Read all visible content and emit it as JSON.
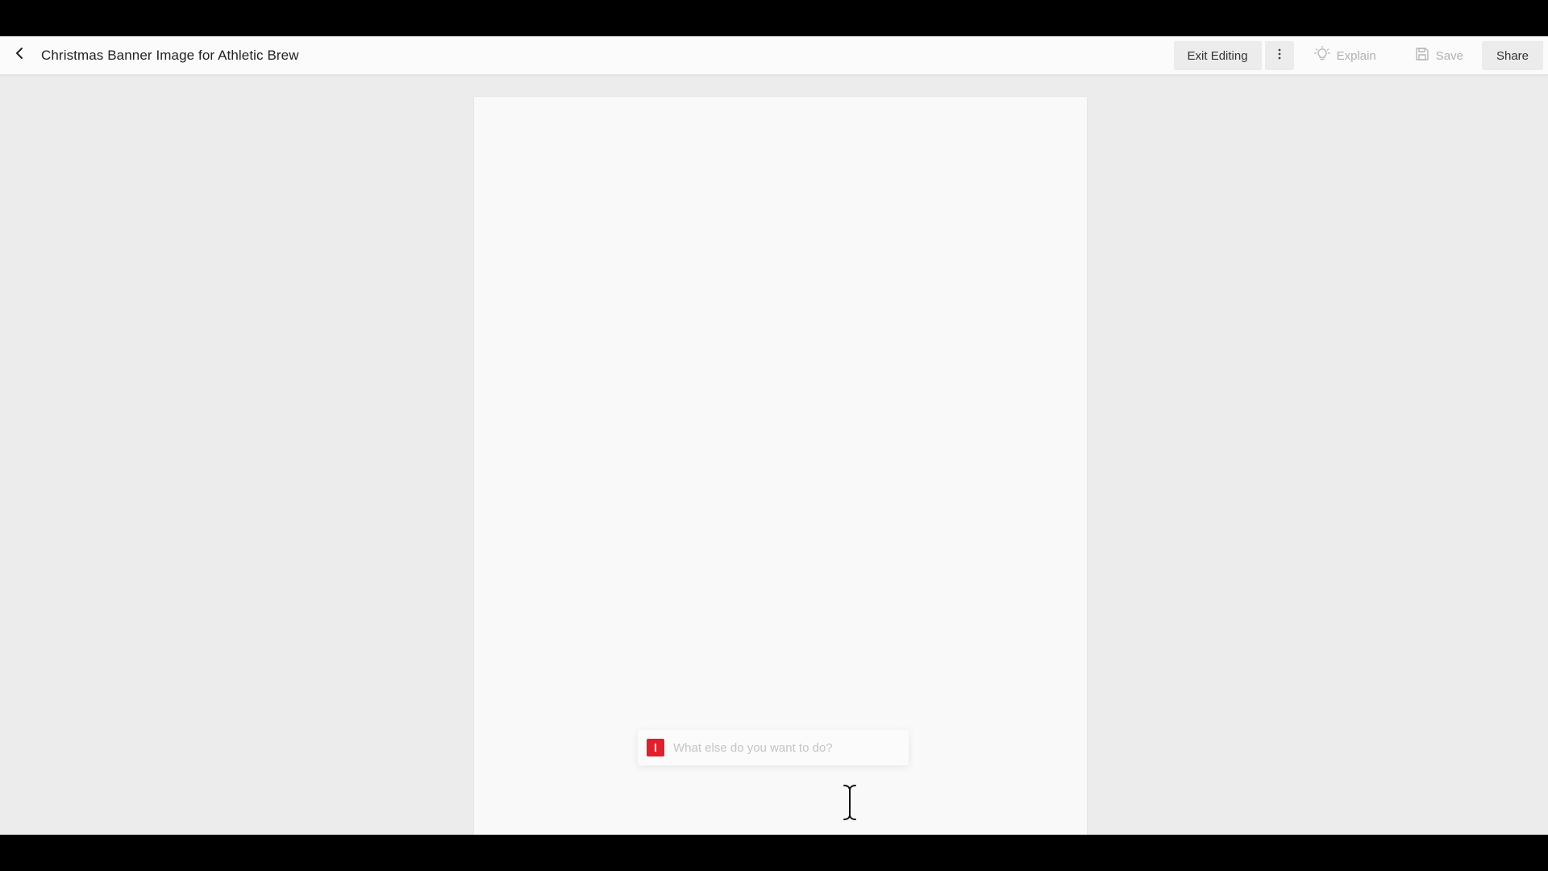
{
  "header": {
    "title": "Christmas Banner Image for Athletic Brew",
    "back_icon": "chevron-left-icon"
  },
  "actions": {
    "exit_editing_label": "Exit Editing",
    "more_icon": "more-vertical-icon",
    "explain_label": "Explain",
    "explain_icon": "lightbulb-icon",
    "save_label": "Save",
    "save_icon": "save-icon",
    "share_label": "Share"
  },
  "prompt": {
    "placeholder": "What else do you want to do?",
    "value": "",
    "logo_color": "#e0202c"
  },
  "colors": {
    "background": "#ececec",
    "canvas": "#f9f9f9",
    "header": "#fbfbfb",
    "disabled_text": "#b0b0b0"
  }
}
